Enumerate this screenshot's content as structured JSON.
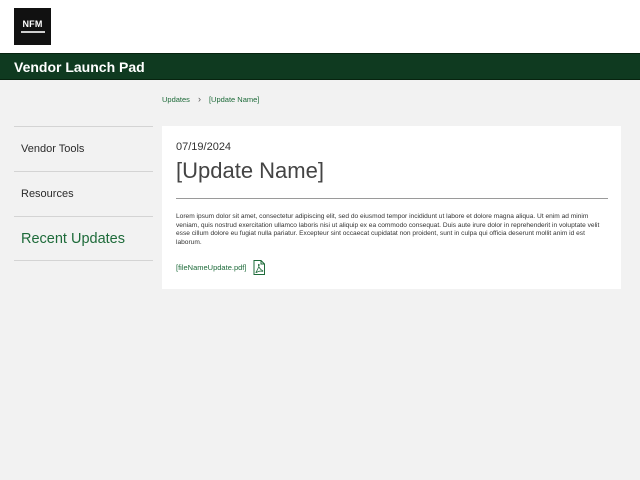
{
  "brand": {
    "logo_text": "NFM"
  },
  "app": {
    "title": "Vendor Launch Pad"
  },
  "breadcrumb": {
    "items": [
      "Updates",
      "[Update Name]"
    ]
  },
  "sidebar": {
    "items": [
      {
        "label": "Vendor Tools"
      },
      {
        "label": "Resources"
      },
      {
        "label": "Recent Updates"
      }
    ]
  },
  "update": {
    "date": "07/19/2024",
    "title": "[Update Name]",
    "body": "Lorem ipsum dolor sit amet, consectetur adipiscing elit, sed do eiusmod tempor incididunt ut labore et dolore magna aliqua. Ut enim ad minim veniam, quis nostrud exercitation ullamco laboris nisi ut aliquip ex ea commodo consequat. Duis aute irure dolor in reprehenderit in voluptate velit esse cillum dolore eu fugiat nulla pariatur. Excepteur sint occaecat cupidatat non proident, sunt in culpa qui officia deserunt mollit anim id est laborum.",
    "attachment": "[fileNameUpdate.pdf]"
  },
  "colors": {
    "brand_green": "#0f3a20",
    "link_green": "#1e6b3a"
  },
  "icons": {
    "attachment_icon": "pdf-file-icon"
  }
}
